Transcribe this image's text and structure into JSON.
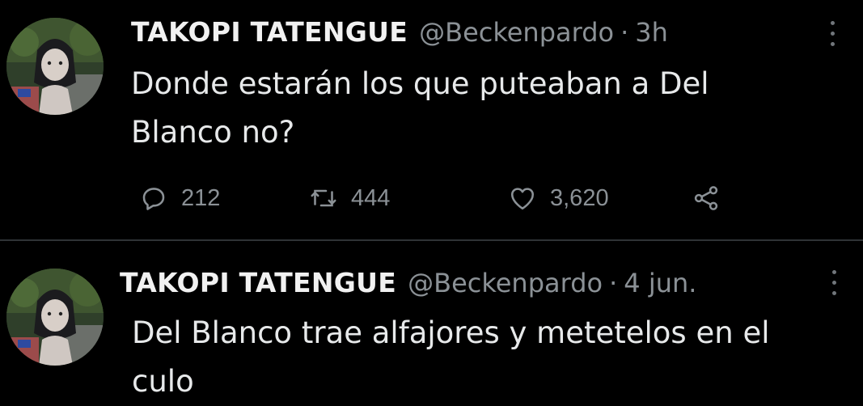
{
  "tweets": [
    {
      "display_name": "TAKOPI TATENGUE",
      "handle": "@Beckenpardo",
      "separator": "·",
      "time": "3h",
      "text": "Donde estarán los que puteaban a Del Blanco no?",
      "replies": "212",
      "retweets": "444",
      "likes": "3,620",
      "icons": [
        "reply-icon",
        "retweet-icon",
        "like-icon",
        "share-icon",
        "more-icon"
      ]
    },
    {
      "display_name": "TAKOPI TATENGUE",
      "handle": "@Beckenpardo",
      "separator": "·",
      "time": "4 jun.",
      "text": "Del Blanco trae alfajores y metetelos en el culo",
      "icons": [
        "more-icon"
      ]
    }
  ],
  "colors": {
    "background": "#000000",
    "text": "#e7e9ea",
    "secondary": "#8b9196",
    "divider": "#2f3336"
  }
}
